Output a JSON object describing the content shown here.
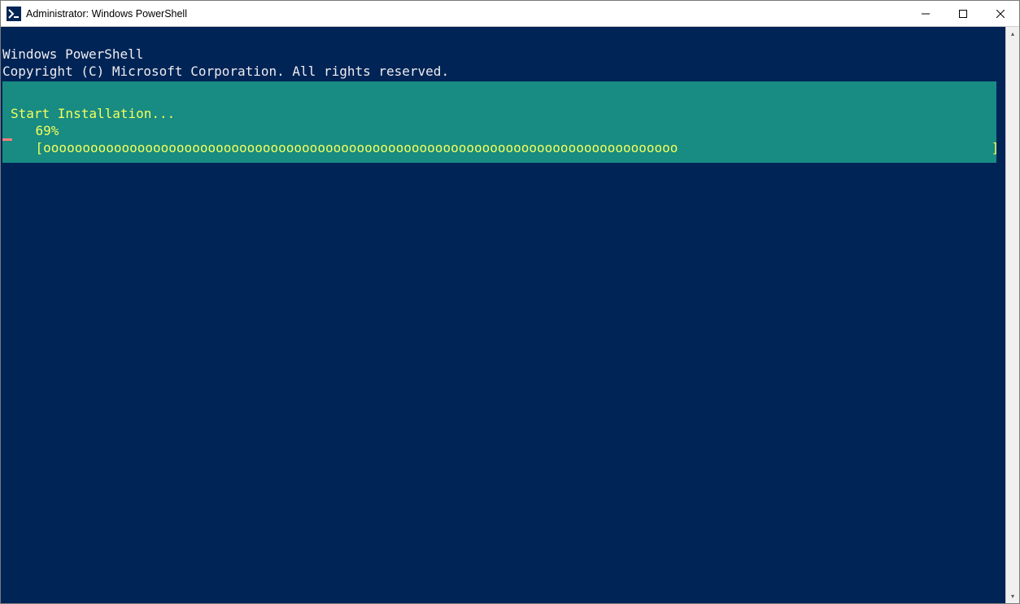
{
  "window": {
    "title": "Administrator: Windows PowerShell"
  },
  "console": {
    "header1": "Windows PowerShell",
    "header2": "Copyright (C) Microsoft Corporation. All rights reserved."
  },
  "progress": {
    "title": "Start Installation...",
    "percent_line": "    69%",
    "bar_line": "    [ooooooooooooooooooooooooooooooooooooooooooooooooooooooooooooooooooooooooooooooooo                                        ]"
  },
  "icons": {
    "minimize": "—",
    "maximize": "☐",
    "close": "✕",
    "scroll_up": "▴",
    "scroll_down": "▾"
  },
  "colors": {
    "console_bg": "#012456",
    "progress_bg": "#188b82",
    "progress_fg": "#f4ff5a",
    "text": "#eeedf0"
  }
}
